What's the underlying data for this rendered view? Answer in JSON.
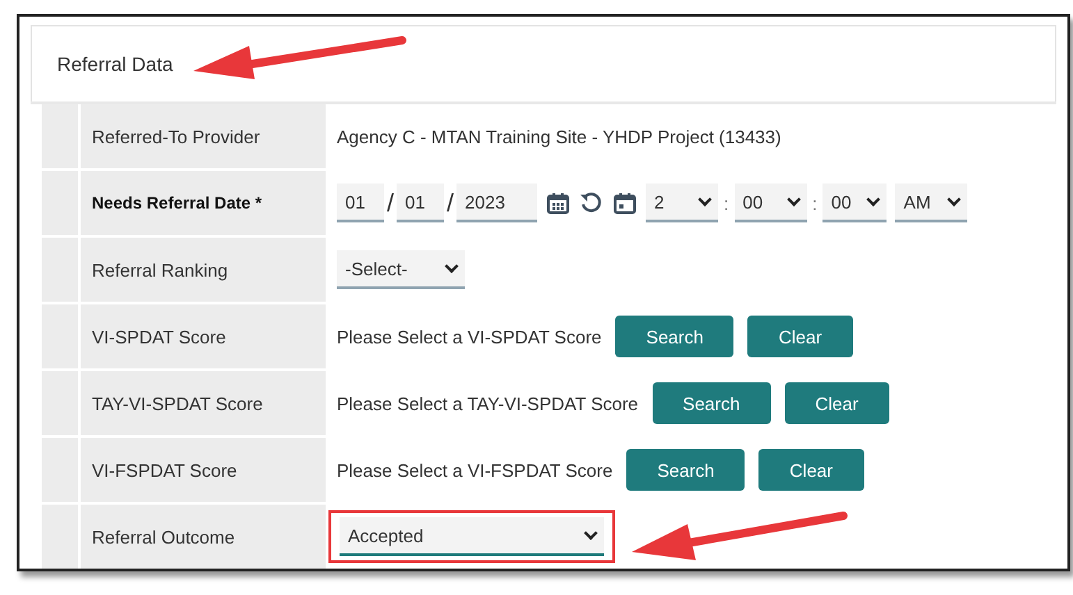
{
  "section": {
    "title": "Referral Data"
  },
  "rows": [
    {
      "kind": "text",
      "label": "Referred-To Provider",
      "required": false,
      "value": "Agency C - MTAN Training Site - YHDP Project (13433)"
    },
    {
      "kind": "datetime",
      "label": "Needs Referral Date *",
      "required": true,
      "date_separator": "/",
      "time_separator": ":",
      "month": "01",
      "day": "01",
      "year": "2023",
      "hour": "2",
      "minute": "00",
      "second": "00",
      "ampm": "AM"
    },
    {
      "kind": "select",
      "label": "Referral Ranking",
      "required": false,
      "value": "-Select-",
      "highlighted": false
    },
    {
      "kind": "score",
      "label": "VI-SPDAT Score",
      "required": false,
      "value": "Please Select a VI-SPDAT Score",
      "buttons": [
        "Search",
        "Clear"
      ]
    },
    {
      "kind": "score",
      "label": "TAY-VI-SPDAT Score",
      "required": false,
      "value": "Please Select a TAY-VI-SPDAT Score",
      "buttons": [
        "Search",
        "Clear"
      ]
    },
    {
      "kind": "score",
      "label": "VI-FSPDAT Score",
      "required": false,
      "value": "Please Select a VI-FSPDAT Score",
      "buttons": [
        "Search",
        "Clear"
      ]
    },
    {
      "kind": "select",
      "label": "Referral Outcome",
      "required": false,
      "value": "Accepted",
      "highlighted": true
    }
  ]
}
